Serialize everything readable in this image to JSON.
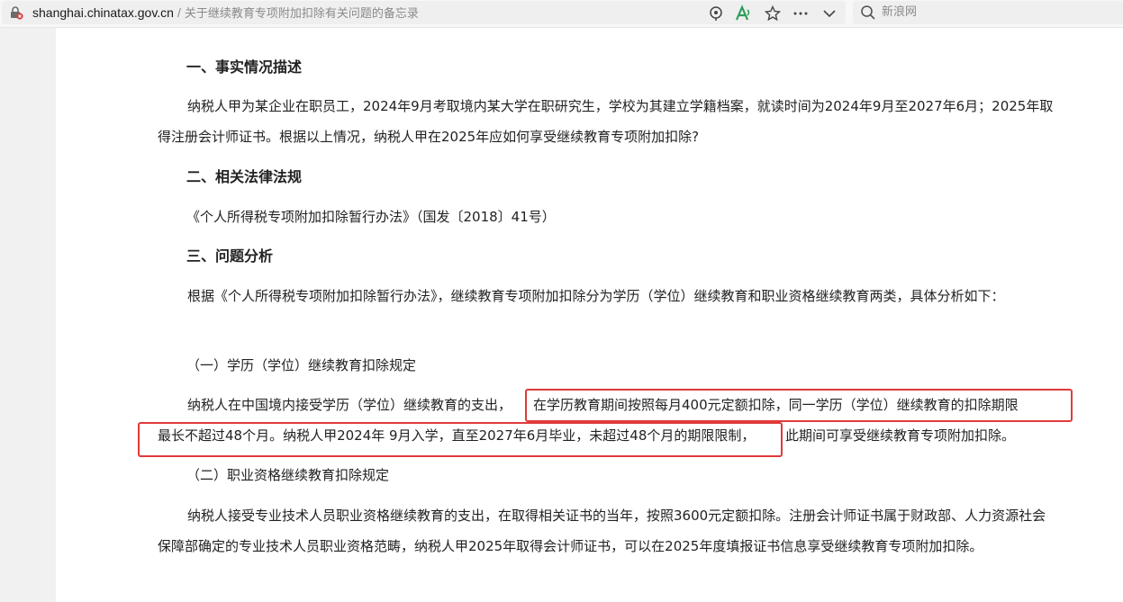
{
  "browser": {
    "domain": "shanghai.chinatax.gov.cn",
    "separator": "/",
    "page_title": "关于继续教育专项附加扣除有关问题的备忘录",
    "search_placeholder": "新浪网"
  },
  "article": {
    "section1_title": "一、事实情况描述",
    "section1_text": "纳税人甲为某企业在职员工，2024年9月考取境内某大学在职研究生，学校为其建立学籍档案，就读时间为2024年9月至2027年6月；2025年取得注册会计师证书。根据以上情况，纳税人甲在2025年应如何享受继续教育专项附加扣除?",
    "section2_title": "二、相关法律法规",
    "section2_text": "《个人所得税专项附加扣除暂行办法》（国发〔2018〕41号）",
    "section3_title": "三、问题分析",
    "section3_text": "根据《个人所得税专项附加扣除暂行办法》，继续教育专项附加扣除分为学历（学位）继续教育和职业资格继续教育两类，具体分析如下：",
    "sub1_title": "（一）学历（学位）继续教育扣除规定",
    "sub1_line1_a": "纳税人在中国境内接受学历（学位）继续教育的支出，",
    "sub1_line1_b": "在学历教育期间按照每月400元定额扣除，同一学历（学位）继续教育的扣除期限",
    "sub1_line2_a": "最长不超过48个月。纳税人甲2024年 9月入学，直至2027年6月毕业，未超过48个月的期限限制，",
    "sub1_line2_b": "此期间可享受继续教育专项附加扣除。",
    "sub2_title": "（二）职业资格继续教育扣除规定",
    "sub2_text": "纳税人接受专业技术人员职业资格继续教育的支出，在取得相关证书的当年，按照3600元定额扣除。注册会计师证书属于财政部、人力资源社会保障部确定的专业技术人员职业资格范畴，纳税人甲2025年取得会计师证书，可以在2025年度填报证书信息享受继续教育专项附加扣除。"
  },
  "colors": {
    "highlight_border": "#e03a3a",
    "reader_icon": "#2e9e5b"
  }
}
